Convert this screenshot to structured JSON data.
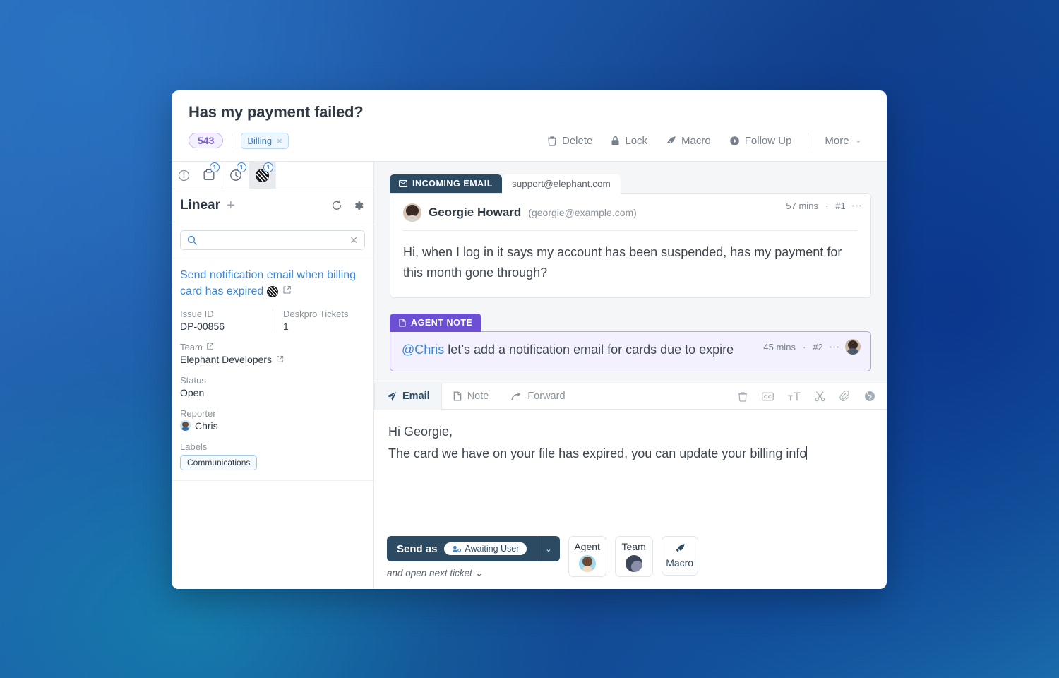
{
  "header": {
    "title": "Has my payment failed?",
    "ticket_number": "543",
    "tag": "Billing",
    "tag_close": "×",
    "actions": [
      {
        "label": "Delete",
        "icon": "trash-icon"
      },
      {
        "label": "Lock",
        "icon": "lock-icon"
      },
      {
        "label": "Macro",
        "icon": "rocket-icon"
      },
      {
        "label": "Follow Up",
        "icon": "flag-icon"
      }
    ],
    "more_label": "More",
    "more_caret": "⌄"
  },
  "sidebar": {
    "tabs": [
      {
        "name": "info-tab",
        "icon": "info-icon",
        "badge": ""
      },
      {
        "name": "tasks-tab",
        "icon": "clipboard-icon",
        "badge": "1"
      },
      {
        "name": "time-tab",
        "icon": "clock-icon",
        "badge": "1"
      },
      {
        "name": "linear-tab",
        "icon": "linear-sphere-icon",
        "badge": "1"
      }
    ],
    "app_title": "Linear",
    "add_label": "+",
    "search_value": "",
    "search_placeholder": "",
    "issue": {
      "title": "Send notification email when billing card has expired",
      "fields": {
        "issue_id_label": "Issue ID",
        "issue_id_value": "DP-00856",
        "deskpro_tickets_label": "Deskpro Tickets",
        "deskpro_tickets_value": "1",
        "team_label": "Team",
        "team_value": "Elephant Developers",
        "status_label": "Status",
        "status_value": "Open",
        "reporter_label": "Reporter",
        "reporter_value": "Chris",
        "labels_label": "Labels",
        "labels_value": "Communications"
      }
    }
  },
  "messages": [
    {
      "type": "INCOMING EMAIL",
      "channel": "support@elephant.com",
      "time": "57 mins",
      "index": "#1",
      "from_name": "Georgie Howard",
      "from_email": "(georgie@example.com)",
      "body": "Hi, when I log in it says my account has been suspended, has my payment for this month gone through?"
    },
    {
      "type": "AGENT NOTE",
      "time": "45 mins",
      "index": "#2",
      "mention": "@Chris",
      "body": " let’s add a notification email for cards due to expire"
    }
  ],
  "composer": {
    "tabs": [
      {
        "label": "Email",
        "icon": "send-icon",
        "active": true
      },
      {
        "label": "Note",
        "icon": "note-icon",
        "active": false
      },
      {
        "label": "Forward",
        "icon": "forward-icon",
        "active": false
      }
    ],
    "tools": [
      "trash-icon",
      "cc-icon",
      "text-size-icon",
      "scissors-icon",
      "paperclip-icon",
      "globe-icon"
    ],
    "draft_line1": "Hi Georgie,",
    "draft_line2": "The card we have on your file has expired, you can update your",
    "draft_line3": "billing info",
    "send_label": "Send as",
    "send_status": "Awaiting User",
    "send_caret": "⌄",
    "send_sub": "and open next ticket",
    "send_sub_caret": "⌄",
    "quick_buttons": [
      {
        "label": "Agent",
        "icon": "agent-avatar"
      },
      {
        "label": "Team",
        "icon": "team-avatar"
      },
      {
        "label": "Macro",
        "icon": "rocket-icon"
      }
    ]
  },
  "colors": {
    "accent_dark": "#2d4a63",
    "note_purple": "#6d4fd6",
    "link_blue": "#3c86d8",
    "badge_purple": "#7b5fd6"
  }
}
